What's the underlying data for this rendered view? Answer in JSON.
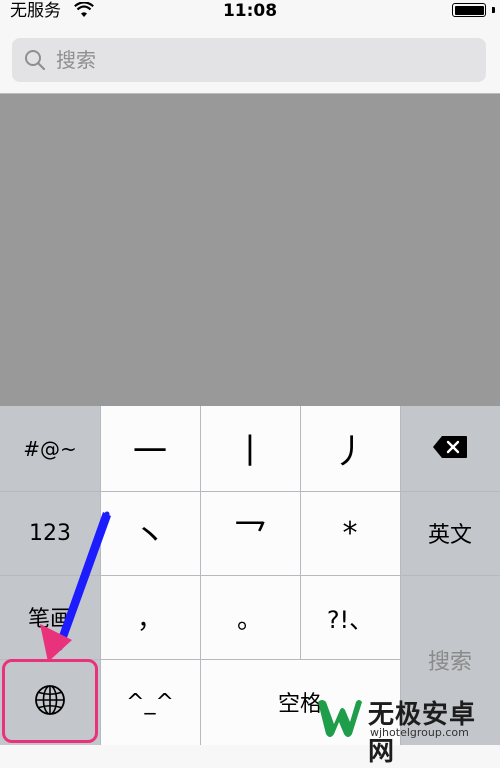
{
  "status_bar": {
    "carrier": "无服务",
    "time": "11:08",
    "battery_level": 1.0
  },
  "search": {
    "placeholder": "搜索",
    "icon": "search-icon"
  },
  "keyboard": {
    "left_keys": [
      "#@~",
      "123",
      "笔画"
    ],
    "globe_icon": "globe-icon",
    "emoji_label": "^_^",
    "stroke_keys": [
      "一",
      "丨",
      "丿",
      "丶",
      "乛",
      "*"
    ],
    "punct_keys": [
      "，",
      "。",
      "?!、"
    ],
    "delete_icon": "delete-backspace-icon",
    "english_label": "英文",
    "space_label": "空格",
    "search_label": "搜索"
  },
  "annotation": {
    "arrow_colors": [
      "#1c1cff",
      "#e8337c"
    ],
    "highlight_color": "#e8337c"
  },
  "watermark": {
    "title": "无极安卓网",
    "url": "wjhotelgroup.com",
    "logo": "w-logo-icon"
  }
}
